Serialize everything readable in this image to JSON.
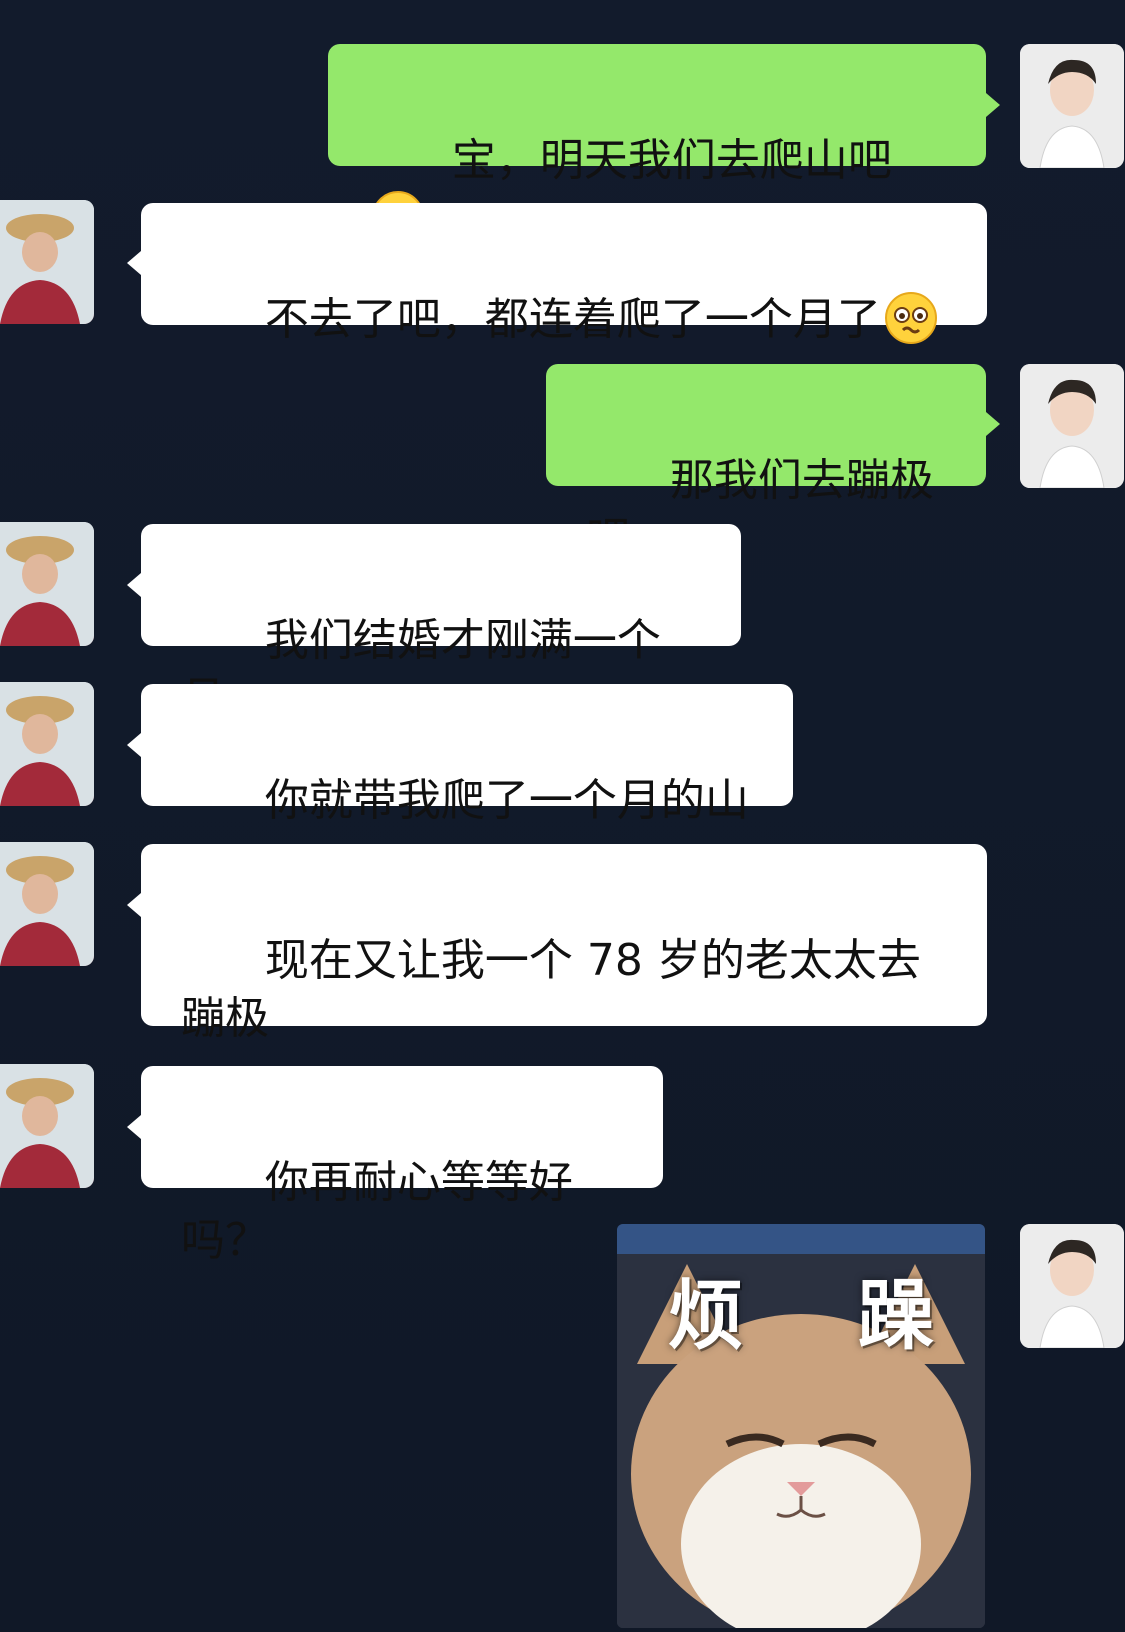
{
  "messages": [
    {
      "side": "me",
      "text": "宝，明天我们去爬山吧",
      "emoji": "smile-emoji"
    },
    {
      "side": "her",
      "text": "不去了吧，都连着爬了一个月了",
      "emoji": "pleading-emoji"
    },
    {
      "side": "me",
      "text": "那我们去蹦极吧"
    },
    {
      "side": "her",
      "text": "我们结婚才刚满一个月"
    },
    {
      "side": "her",
      "text": "你就带我爬了一个月的山"
    },
    {
      "side": "her",
      "text": "现在又让我一个 78 岁的老太太去\n蹦极"
    },
    {
      "side": "her",
      "text": "你再耐心等等好吗？"
    },
    {
      "side": "me",
      "sticker": "cat-sticker",
      "sticker_text": "烦 躁"
    }
  ],
  "colors": {
    "background": "#111a2b",
    "my_bubble": "#94e86b",
    "her_bubble": "#ffffff"
  }
}
